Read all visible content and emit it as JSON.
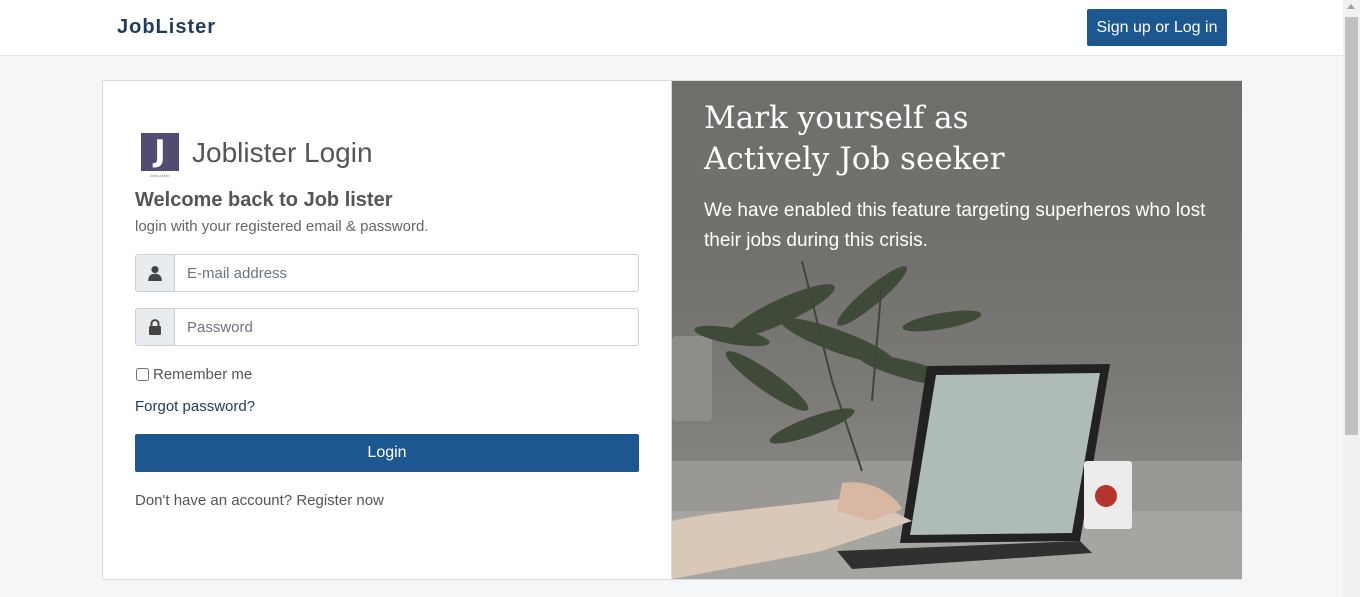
{
  "navbar": {
    "brand": "JobLister",
    "auth_button": "Sign up or Log in"
  },
  "login": {
    "logo_letter": "J",
    "logo_caption": "JobLister",
    "title": "Joblister Login",
    "welcome": "Welcome back to Job lister",
    "subtitle": "login with your registered email & password.",
    "email_placeholder": "E-mail address",
    "password_placeholder": "Password",
    "remember_label": "Remember me",
    "forgot_link": "Forgot password?",
    "login_button": "Login",
    "register_prompt": "Don't have an account?",
    "register_link": "Register now"
  },
  "promo": {
    "heading_line1": "Mark yourself as",
    "heading_line2": "Actively Job seeker",
    "text": "We have enabled this feature targeting superheros who lost their jobs during this crisis."
  },
  "icons": {
    "email_addon": "user-icon",
    "password_addon": "lock-icon"
  },
  "colors": {
    "brand": "#1f3b5c",
    "primary_button": "#1d5790",
    "logo_bg": "#534c72"
  }
}
